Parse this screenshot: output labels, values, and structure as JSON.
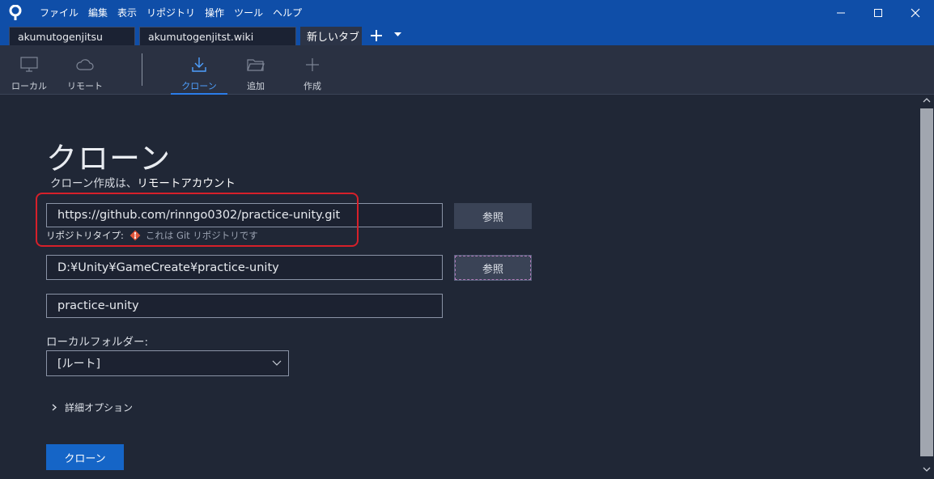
{
  "menu": [
    "ファイル",
    "編集",
    "表示",
    "リポジトリ",
    "操作",
    "ツール",
    "ヘルプ"
  ],
  "tabs": [
    {
      "label": "akumutogenjitsu"
    },
    {
      "label": "akumutogenjitst.wiki"
    },
    {
      "label": "新しいタブ"
    }
  ],
  "toolbar": {
    "local": "ローカル",
    "remote": "リモート",
    "clone": "クローン",
    "add": "追加",
    "create": "作成"
  },
  "clone": {
    "title": "クローン",
    "subtitle_prefix": "クローン作成は、",
    "subtitle_link": "リモートアカウント",
    "url_value": "https://github.com/rinngo0302/practice-unity.git",
    "repo_type_label": "リポジトリタイプ:",
    "repo_type_value": "これは Git リポジトリです",
    "browse_label_1": "参照",
    "path_value": "D:¥Unity¥GameCreate¥practice-unity",
    "browse_label_2": "参照",
    "name_value": "practice-unity",
    "local_folder_label": "ローカルフォルダー:",
    "local_folder_value": "[ルート]",
    "advanced_label": "詳細オプション",
    "clone_button": "クローン"
  },
  "colors": {
    "titlebar": "#0f4ea8",
    "accent": "#2b7de9",
    "primary_button": "#1565c7",
    "annotation": "#d6202a",
    "git_badge": "#e2553a"
  }
}
